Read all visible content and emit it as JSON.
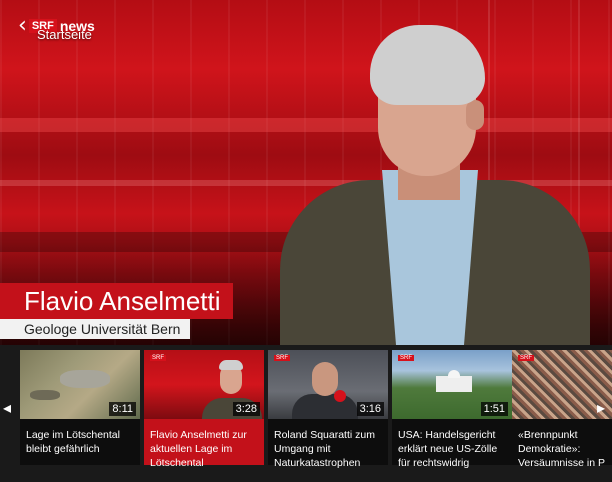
{
  "header": {
    "brand_tag": "SRF",
    "brand_name": "news",
    "back_label": "Startseite"
  },
  "lower_third": {
    "name": "Flavio Anselmetti",
    "role": "Geologe Universität Bern"
  },
  "rail": {
    "items": [
      {
        "duration": "8:11",
        "title": "Lage im Lötschental bleibt gefährlich",
        "thumb_icon": "flood-aerial-thumbnail"
      },
      {
        "duration": "3:28",
        "title": "Flavio Anselmetti zur aktuellen Lage im Lötschental",
        "thumb_icon": "studio-interview-thumbnail"
      },
      {
        "duration": "3:16",
        "title": "Roland Squaratti zum Umgang mit Naturkatastrophen",
        "thumb_icon": "interview-thumbnail"
      },
      {
        "duration": "1:51",
        "title": "USA: Handelsgericht erklärt neue US-Zölle für rechtswidrig",
        "thumb_icon": "white-house-thumbnail"
      },
      {
        "duration": "",
        "title": "«Brennpunkt Demokratie»: Versäumnisse in P",
        "thumb_icon": "crowd-thumbnail"
      }
    ]
  },
  "colors": {
    "accent": "#c3111a",
    "studio_red": "#d0141b"
  }
}
